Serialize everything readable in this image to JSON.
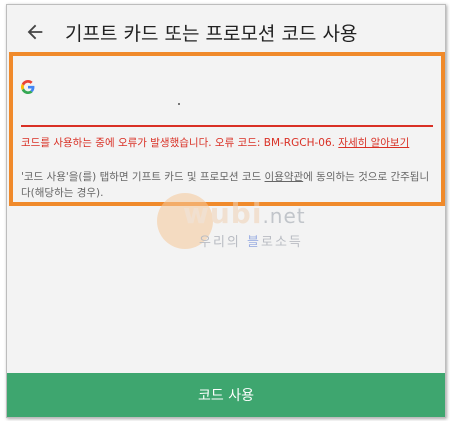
{
  "appbar": {
    "title": "기프트 카드 또는 프로모션 코드 사용"
  },
  "form": {
    "input_value": "",
    "error_prefix": "코드를 사용하는 중에 오류가 발생했습니다. 오류 코드: BM-RGCH-06. ",
    "error_link": "자세히 알아보기",
    "terms_prefix": "'코드 사용'을(를) 탭하면 기프트 카드 및 프로모션 코드 ",
    "terms_link": "이용약관",
    "terms_suffix": "에 동의하는 것으로 간주됩니다(해당하는 경우)."
  },
  "watermark": {
    "main": "wubi",
    "domain": ".net",
    "sub_1": "우리의 ",
    "sub_2": "블",
    "sub_3": "로소득"
  },
  "bottom_button": {
    "label": "코드 사용"
  },
  "colors": {
    "accent_green": "#3ea66f",
    "error_red": "#d93025",
    "highlight_orange": "#f08a2b"
  },
  "icons": {
    "back": "arrow-left-icon",
    "brand": "google-g-icon"
  }
}
